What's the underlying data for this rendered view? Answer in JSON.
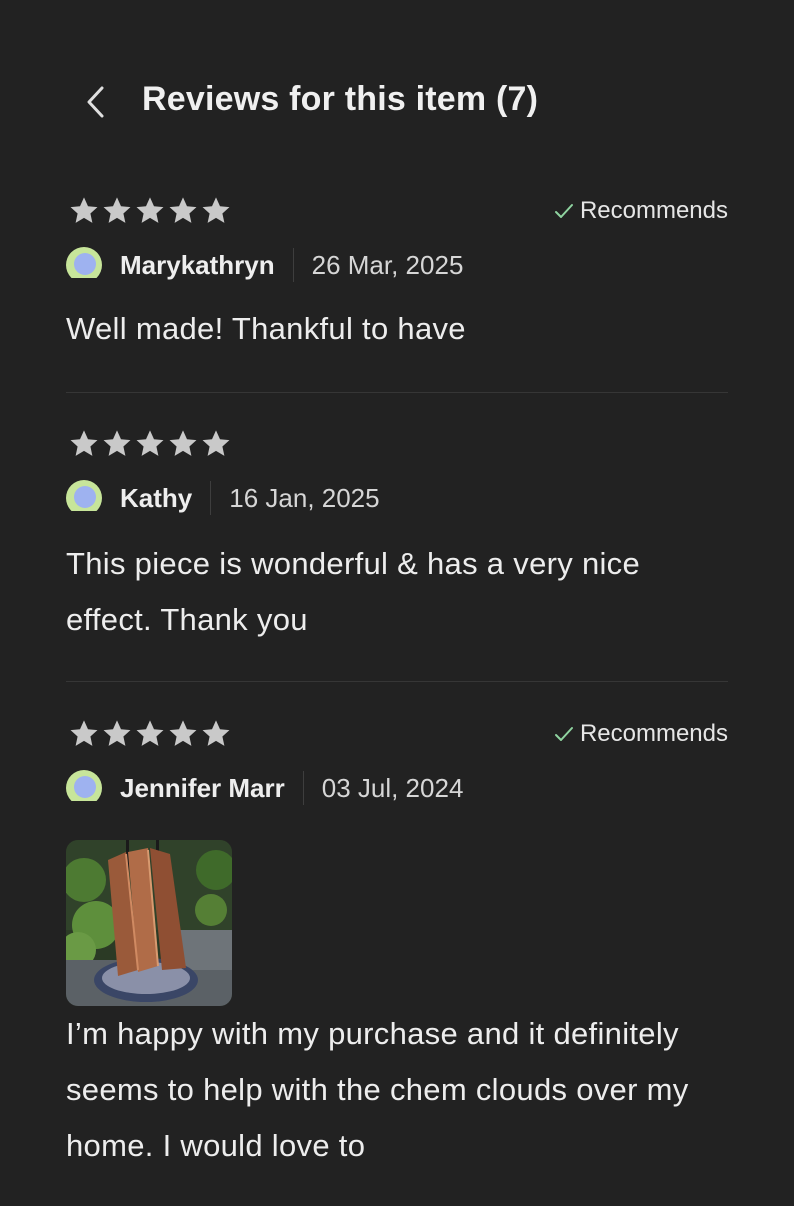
{
  "header": {
    "title": "Reviews for this item (7)",
    "back_icon": "chevron-left-icon"
  },
  "reviews": [
    {
      "rating": 5,
      "recommends": true,
      "recommends_label": "Recommends",
      "reviewer": "Marykathryn",
      "date": "26 Mar, 2025",
      "text": "Well made! Thankful to have"
    },
    {
      "rating": 5,
      "recommends": false,
      "reviewer": "Kathy",
      "date": "16 Jan, 2025",
      "text": "This piece is wonderful & has a very nice effect. Thank you"
    },
    {
      "rating": 5,
      "recommends": true,
      "recommends_label": "Recommends",
      "reviewer": "Jennifer Marr",
      "date": "03 Jul, 2024",
      "has_photo": true,
      "text": "I’m happy with my purchase and it definitely seems to help with the chem clouds over my home. I would love to"
    }
  ],
  "colors": {
    "background": "#222222",
    "star": "#c9c9c9",
    "check": "#8fd4a0",
    "avatar_outer": "#c7e59a",
    "avatar_inner": "#9eb2f0"
  }
}
